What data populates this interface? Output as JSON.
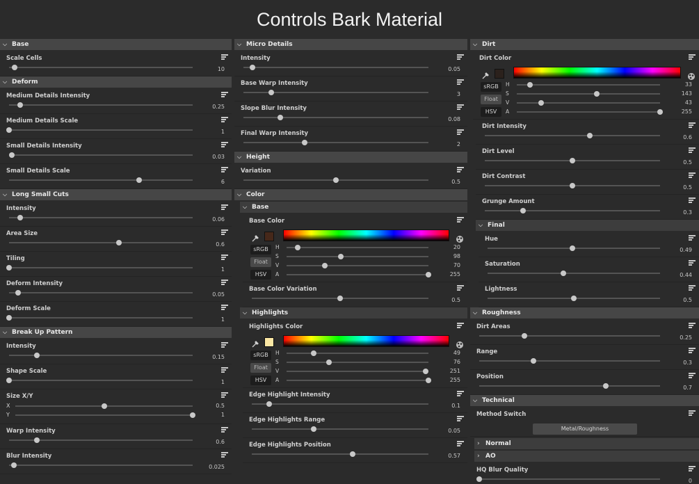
{
  "title": "Controls Bark Material",
  "col1": [
    {
      "type": "section",
      "label": "Base"
    },
    {
      "type": "slider",
      "label": "Scale Cells",
      "value": "10",
      "pos": 0.03
    },
    {
      "type": "section",
      "label": "Deform"
    },
    {
      "type": "slider",
      "label": "Medium Details Intensity",
      "value": "0.25",
      "pos": 0.06
    },
    {
      "type": "slider",
      "label": "Medium Details Scale",
      "value": "1",
      "pos": 0.0
    },
    {
      "type": "slider",
      "label": "Small Details Intensity",
      "value": "0.03",
      "pos": 0.015
    },
    {
      "type": "slider",
      "label": "Small Details Scale",
      "value": "6",
      "pos": 0.71
    },
    {
      "type": "section",
      "label": "Long Small Cuts"
    },
    {
      "type": "slider",
      "label": "Intensity",
      "value": "0.06",
      "pos": 0.06
    },
    {
      "type": "slider",
      "label": "Area Size",
      "value": "0.6",
      "pos": 0.6
    },
    {
      "type": "slider",
      "label": "Tiling",
      "value": "1",
      "pos": 0.0
    },
    {
      "type": "slider",
      "label": "Deform Intensity",
      "value": "0.05",
      "pos": 0.05
    },
    {
      "type": "slider",
      "label": "Deform Scale",
      "value": "1",
      "pos": 0.0
    },
    {
      "type": "section",
      "label": "Break Up Pattern"
    },
    {
      "type": "slider",
      "label": "Intensity",
      "value": "0.15",
      "pos": 0.15
    },
    {
      "type": "slider",
      "label": "Shape Scale",
      "value": "1",
      "pos": 0.0
    },
    {
      "type": "xy",
      "label": "Size X/Y",
      "rows": [
        {
          "axis": "X",
          "value": "0.5",
          "pos": 0.5
        },
        {
          "axis": "Y",
          "value": "1",
          "pos": 1.0
        }
      ]
    },
    {
      "type": "slider",
      "label": "Warp Intensity",
      "value": "0.6",
      "pos": 0.15
    },
    {
      "type": "slider",
      "label": "Blur Intensity",
      "value": "0.025",
      "pos": 0.025
    }
  ],
  "col2": [
    {
      "type": "section",
      "label": "Micro Details"
    },
    {
      "type": "slider",
      "label": "Intensity",
      "value": "0.05",
      "pos": 0.05
    },
    {
      "type": "slider",
      "label": "Base Warp Intensity",
      "value": "3",
      "pos": 0.15
    },
    {
      "type": "slider",
      "label": "Slope Blur Intensity",
      "value": "0.08",
      "pos": 0.2
    },
    {
      "type": "slider",
      "label": "Final Warp Intensity",
      "value": "2",
      "pos": 0.33
    },
    {
      "type": "section",
      "label": "Height"
    },
    {
      "type": "slider",
      "label": "Variation",
      "value": "0.5",
      "pos": 0.5
    },
    {
      "type": "section",
      "label": "Color"
    },
    {
      "type": "subsection",
      "label": "Base"
    },
    {
      "type": "color",
      "label": "Base Color",
      "swatch": "#46281a",
      "mode": "Float",
      "channels": [
        {
          "ch": "H",
          "value": "20",
          "pos": 0.08
        },
        {
          "ch": "S",
          "value": "98",
          "pos": 0.38
        },
        {
          "ch": "V",
          "value": "70",
          "pos": 0.27
        },
        {
          "ch": "A",
          "value": "255",
          "pos": 1.0
        }
      ]
    },
    {
      "type": "subslider",
      "label": "Base Color Variation",
      "value": "0.5",
      "pos": 0.5
    },
    {
      "type": "subsection",
      "label": "Highlights"
    },
    {
      "type": "color",
      "label": "Highlights Color",
      "swatch": "#fbe7a4",
      "mode": "Float",
      "channels": [
        {
          "ch": "H",
          "value": "49",
          "pos": 0.19
        },
        {
          "ch": "S",
          "value": "76",
          "pos": 0.3
        },
        {
          "ch": "V",
          "value": "251",
          "pos": 0.98
        },
        {
          "ch": "A",
          "value": "255",
          "pos": 1.0
        }
      ]
    },
    {
      "type": "subslider",
      "label": "Edge Highlight Intensity",
      "value": "0.1",
      "pos": 0.1
    },
    {
      "type": "subslider",
      "label": "Edge Highlights Range",
      "value": "0.05",
      "pos": 0.35
    },
    {
      "type": "subslider",
      "label": "Edge Highlights Position",
      "value": "0.57",
      "pos": 0.57
    }
  ],
  "col3": [
    {
      "type": "section",
      "label": "Dirt"
    },
    {
      "type": "color",
      "label": "Dirt Color",
      "swatch": "#2b211c",
      "mode": "Float",
      "channels": [
        {
          "ch": "H",
          "value": "33",
          "pos": 0.09
        },
        {
          "ch": "S",
          "value": "143",
          "pos": 0.56
        },
        {
          "ch": "V",
          "value": "43",
          "pos": 0.17
        },
        {
          "ch": "A",
          "value": "255",
          "pos": 1.0
        }
      ]
    },
    {
      "type": "subslider",
      "label": "Dirt Intensity",
      "value": "0.6",
      "pos": 0.6
    },
    {
      "type": "subslider",
      "label": "Dirt Level",
      "value": "0.5",
      "pos": 0.5
    },
    {
      "type": "subslider",
      "label": "Dirt Contrast",
      "value": "0.5",
      "pos": 0.5
    },
    {
      "type": "subslider",
      "label": "Grunge Amount",
      "value": "0.3",
      "pos": 0.22
    },
    {
      "type": "subsection",
      "label": "Final"
    },
    {
      "type": "subslider",
      "label": "Hue",
      "value": "0.49",
      "pos": 0.49
    },
    {
      "type": "subslider",
      "label": "Saturation",
      "value": "0.44",
      "pos": 0.44
    },
    {
      "type": "subslider",
      "label": "Lightness",
      "value": "0.5",
      "pos": 0.5
    },
    {
      "type": "section",
      "label": "Roughness"
    },
    {
      "type": "slider",
      "label": "Dirt Areas",
      "value": "0.25",
      "pos": 0.25
    },
    {
      "type": "slider",
      "label": "Range",
      "value": "0.3",
      "pos": 0.3
    },
    {
      "type": "slider",
      "label": "Position",
      "value": "0.7",
      "pos": 0.7
    },
    {
      "type": "section",
      "label": "Technical"
    },
    {
      "type": "dropdown",
      "label": "Method Switch",
      "value": "Metal/Roughness"
    },
    {
      "type": "collapsed",
      "label": "Normal"
    },
    {
      "type": "collapsed",
      "label": "AO"
    },
    {
      "type": "slider",
      "label": "HQ Blur Quality",
      "value": "0",
      "pos": 0.0
    }
  ],
  "color_modes": [
    "sRGB",
    "Float",
    "HSV"
  ],
  "icons": {
    "reset": "reset-menu-icon",
    "picker": "eyedropper-icon",
    "wheel": "color-wheel-icon",
    "expand": "chevron-down-icon",
    "collapse": "chevron-right-icon"
  },
  "colors": {
    "background": "#2b2b2b",
    "section_header": "#464646",
    "track": "#545454",
    "knob": "#c8c8c8"
  }
}
